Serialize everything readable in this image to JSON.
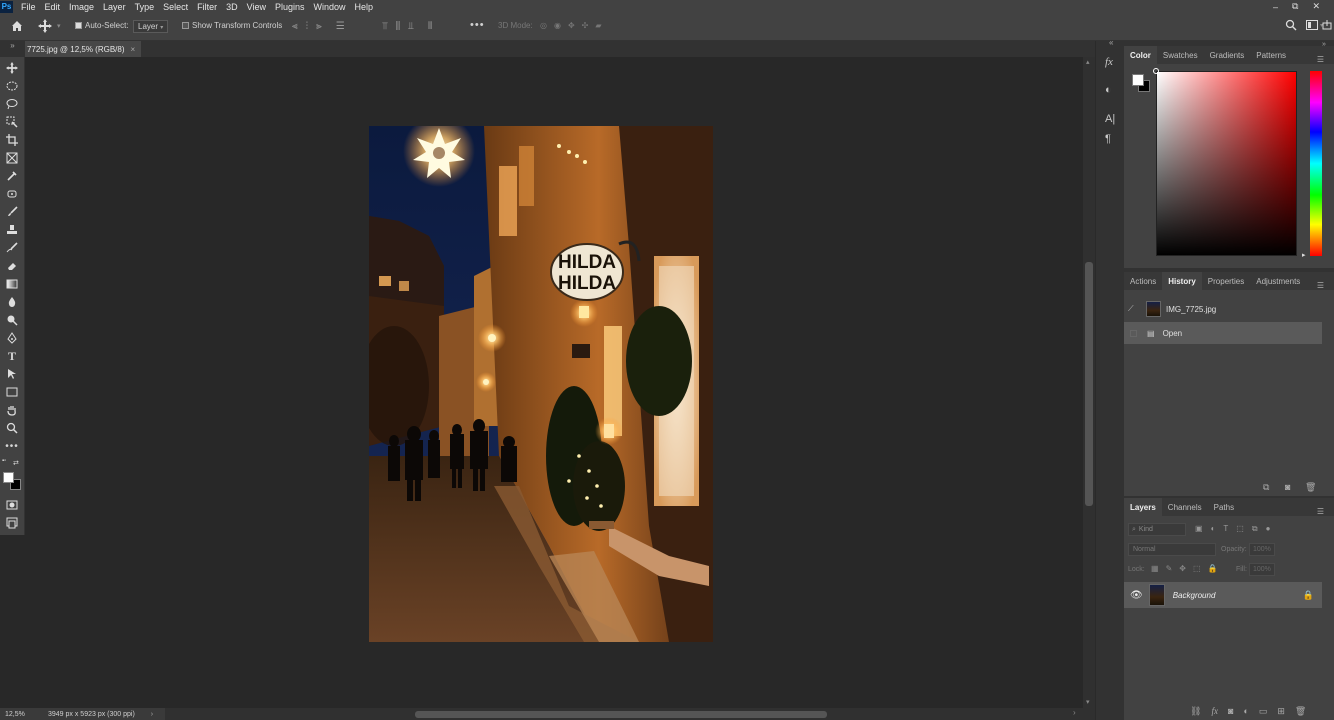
{
  "menubar": {
    "logo": "Ps",
    "items": [
      "File",
      "Edit",
      "Image",
      "Layer",
      "Type",
      "Select",
      "Filter",
      "3D",
      "View",
      "Plugins",
      "Window",
      "Help"
    ],
    "window_controls": [
      "–",
      "⧉",
      "✕"
    ]
  },
  "options_bar": {
    "auto_select_label": "Auto-Select:",
    "auto_select_checked": true,
    "auto_select_target": "Layer",
    "show_transform_label": "Show Transform Controls",
    "more": "•••",
    "mode_3d_label": "3D Mode:"
  },
  "document_tab": {
    "title": "7725.jpg @ 12,5% (RGB/8)",
    "close": "×"
  },
  "status": {
    "zoom": "12,5%",
    "dimensions": "3949 px x 5923 px (300 ppi)",
    "arrow": "›"
  },
  "tools": [
    "move-tool",
    "elliptical-marquee-tool",
    "lasso-tool",
    "object-selection-tool",
    "crop-tool",
    "frame-tool",
    "eyedropper-tool",
    "spot-healing-tool",
    "brush-tool",
    "clone-stamp-tool",
    "history-brush-tool",
    "eraser-tool",
    "gradient-tool",
    "blur-tool",
    "dodge-tool",
    "pen-tool",
    "type-tool",
    "path-selection-tool",
    "rectangle-tool",
    "hand-tool",
    "zoom-tool",
    "edit-toolbar"
  ],
  "color_panel": {
    "tabs": [
      "Color",
      "Swatches",
      "Gradients",
      "Patterns"
    ],
    "active": "Color",
    "foreground": "#ffffff",
    "background": "#000000"
  },
  "history_panel": {
    "tabs": [
      "Actions",
      "History",
      "Properties",
      "Adjustments"
    ],
    "active": "History",
    "snapshot": "IMG_7725.jpg",
    "states": [
      "Open"
    ]
  },
  "layers_panel": {
    "tabs": [
      "Layers",
      "Channels",
      "Paths"
    ],
    "active": "Layers",
    "kind_placeholder": "Kind",
    "blend_mode": "Normal",
    "opacity_label": "Opacity:",
    "opacity_value": "100%",
    "lock_label": "Lock:",
    "fill_label": "Fill:",
    "fill_value": "100%",
    "layers": [
      {
        "name": "Background",
        "visible": true,
        "locked": true
      }
    ]
  },
  "photo": {
    "sign_line1": "HILDA",
    "sign_line2": "HILDA"
  }
}
